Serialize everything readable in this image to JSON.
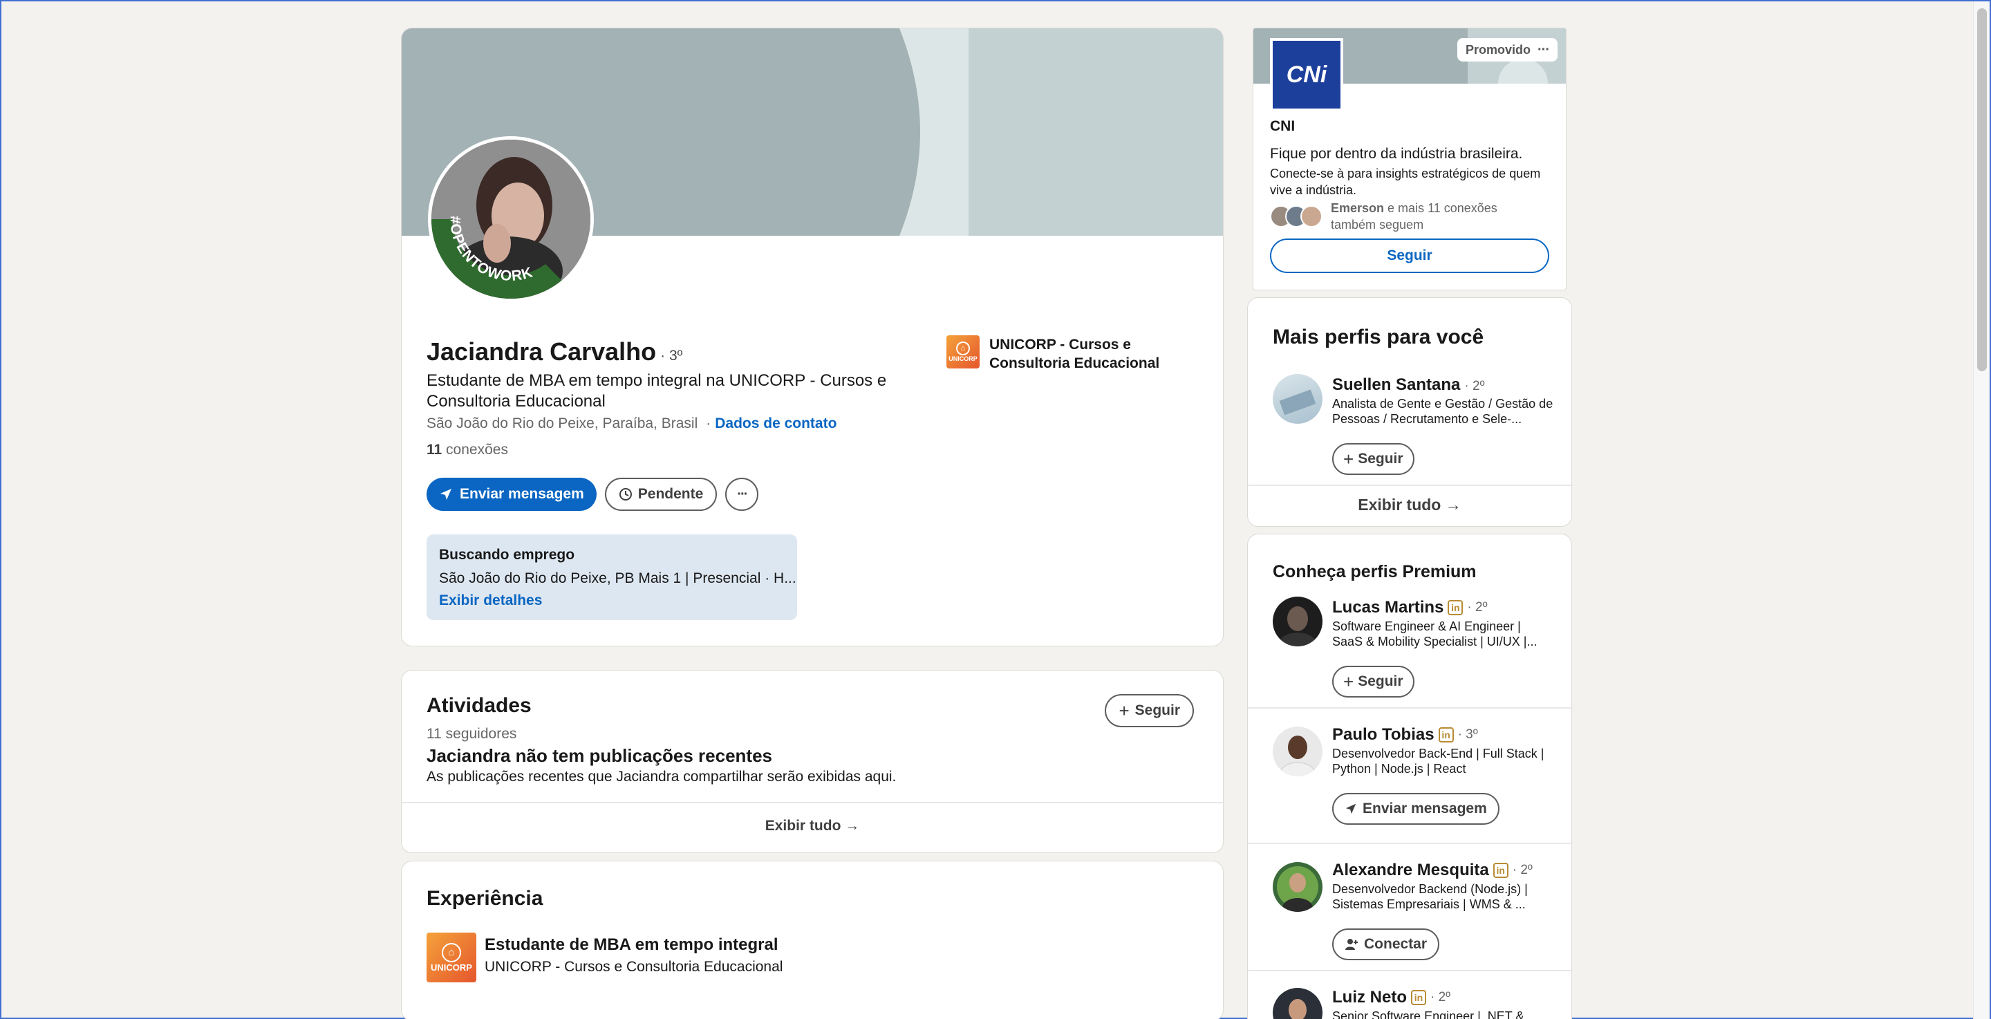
{
  "profile": {
    "name": "Jaciandra Carvalho",
    "degree": "· 3º",
    "headline": "Estudante de MBA em tempo integral na UNICORP - Cursos e Consultoria Educacional",
    "location": "São João do Rio do Peixe, Paraíba, Brasil",
    "contact_link": "Dados de contato",
    "connections_count": "11",
    "connections_label": "conexões",
    "open_to_work_text": "#OPENTOWORK",
    "company_name": "UNICORP - Cursos e Consultoria Educacional",
    "company_logo_text": "UNICORP",
    "actions": {
      "message": "Enviar mensagem",
      "pending": "Pendente",
      "more": "···"
    },
    "job_seeking": {
      "title": "Buscando emprego",
      "detail": "São João do Rio do Peixe, PB Mais 1 | Presencial · H...",
      "link": "Exibir detalhes"
    }
  },
  "activity": {
    "title": "Atividades",
    "followers": "11 seguidores",
    "follow": "Seguir",
    "empty_title": "Jaciandra não tem publicações recentes",
    "empty_desc": "As publicações recentes que Jaciandra compartilhar serão exibidas aqui.",
    "show_all": "Exibir tudo →"
  },
  "experience": {
    "title": "Experiência",
    "items": [
      {
        "role": "Estudante de MBA em tempo integral",
        "company": "UNICORP - Cursos e Consultoria Educacional",
        "logo_text": "UNICORP"
      }
    ]
  },
  "ad": {
    "promoted": "Promovido",
    "more": "···",
    "logo_text": "CNi",
    "company": "CNI",
    "tagline": "Fique por dentro da indústria brasileira.",
    "desc": "Conecte-se à para insights estratégicos de quem vive a indústria.",
    "social_name": "Emerson",
    "social_rest": "e mais 11 conexões também seguem",
    "follow": "Seguir"
  },
  "more_profiles": {
    "title": "Mais perfis para você",
    "people": [
      {
        "name": "Suellen Santana",
        "degree": "· 2º",
        "headline": "Analista de Gente e Gestão / Gestão de Pessoas / Recrutamento e Sele-...",
        "action": "Seguir"
      }
    ],
    "show_all": "Exibir tudo →"
  },
  "premium": {
    "title": "Conheça perfis Premium",
    "badge": "in",
    "people": [
      {
        "name": "Lucas Martins",
        "degree": "· 2º",
        "headline": "Software Engineer & AI Engineer | SaaS & Mobility Specialist | UI/UX |...",
        "action": "Seguir"
      },
      {
        "name": "Paulo Tobias",
        "degree": "· 3º",
        "headline": "Desenvolvedor Back-End | Full Stack | Python | Node.js | React",
        "action": "Enviar mensagem"
      },
      {
        "name": "Alexandre Mesquita",
        "degree": "· 2º",
        "headline": "Desenvolvedor Backend (Node.js) | Sistemas Empresariais | WMS & ...",
        "action": "Conectar"
      },
      {
        "name": "Luiz Neto",
        "degree": "· 2º",
        "headline": "Senior Software Engineer | .NET &",
        "action": ""
      }
    ]
  },
  "colors": {
    "accent": "#0a66c2",
    "banner": "#a3b2b5",
    "open_to_work": "#2f6b2f",
    "premium_gold": "#b78b34"
  }
}
